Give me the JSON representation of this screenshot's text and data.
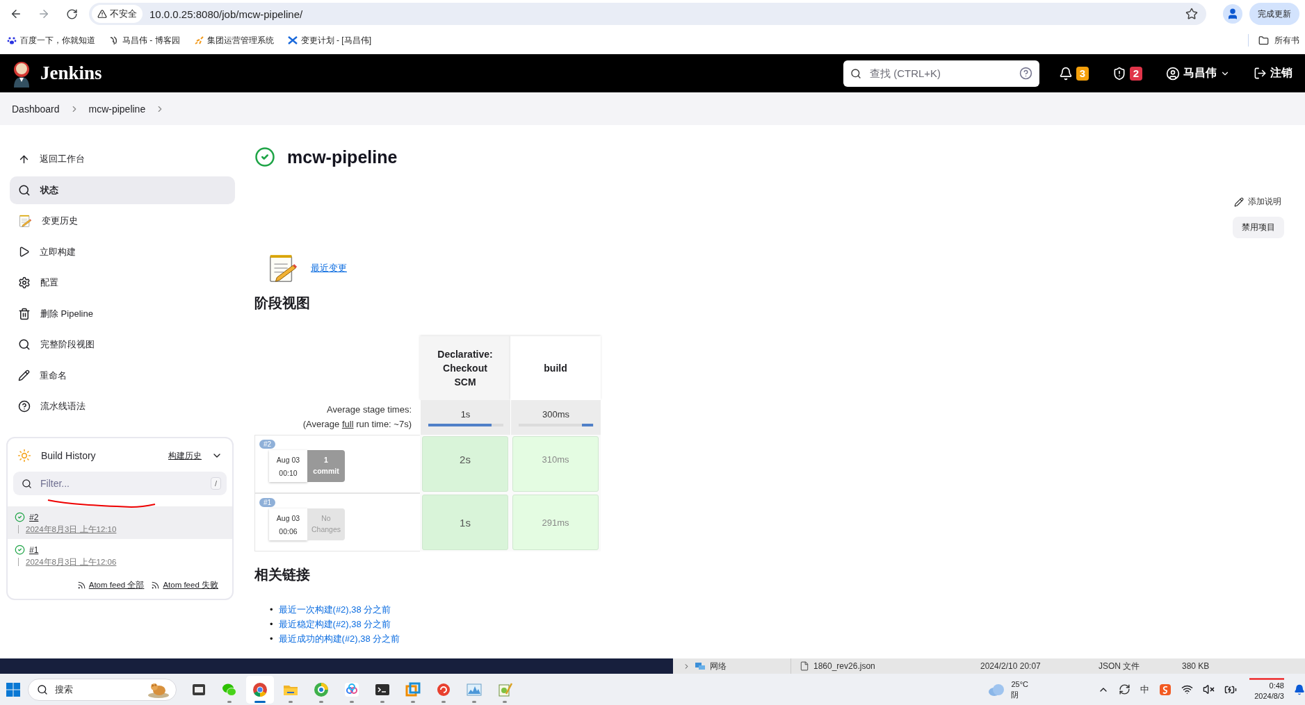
{
  "browser": {
    "security_label": "不安全",
    "url": "10.0.0.25:8080/job/mcw-pipeline/",
    "update_button": "完成更新",
    "bookmarks": [
      "百度一下，你就知道",
      "马昌伟 - 博客园",
      "集团运营管理系统",
      "变更计划 - [马昌伟]"
    ],
    "all_bookmarks": "所有书"
  },
  "header": {
    "brand": "Jenkins",
    "search_placeholder": "查找 (CTRL+K)",
    "notifications": "3",
    "security_warnings": "2",
    "user": "马昌伟",
    "logout": "注销"
  },
  "breadcrumbs": [
    "Dashboard",
    "mcw-pipeline"
  ],
  "sidebar": {
    "items": [
      {
        "label": "返回工作台",
        "selected": false
      },
      {
        "label": "状态",
        "selected": true
      },
      {
        "label": "变更历史",
        "selected": false
      },
      {
        "label": "立即构建",
        "selected": false
      },
      {
        "label": "配置",
        "selected": false
      },
      {
        "label": "删除 Pipeline",
        "selected": false
      },
      {
        "label": "完整阶段视图",
        "selected": false
      },
      {
        "label": "重命名",
        "selected": false
      },
      {
        "label": "流水线语法",
        "selected": false
      }
    ]
  },
  "build_history": {
    "title": "Build History",
    "history_link": "构建历史",
    "filter_placeholder": "Filter...",
    "filter_shortcut": "/",
    "builds": [
      {
        "number": "#2",
        "time": "2024年8月3日 上午12:10",
        "selected": true
      },
      {
        "number": "#1",
        "time": "2024年8月3日 上午12:06",
        "selected": false
      }
    ],
    "feeds": [
      "Atom feed 全部",
      "Atom feed 失败"
    ]
  },
  "job": {
    "title": "mcw-pipeline",
    "add_description": "添加说明",
    "disable_button": "禁用项目",
    "recent_changes": "最近变更"
  },
  "stage_view": {
    "heading": "阶段视图",
    "avg_label": "Average stage times:",
    "avg_prefix": "(Average",
    "avg_link": "full",
    "avg_suffix": "run time: ~7s)",
    "stages": [
      {
        "name": "Declarative: Checkout SCM",
        "avg": "1s",
        "level": 0.85
      },
      {
        "name": "build",
        "avg": "300ms",
        "level": 0.15
      }
    ],
    "runs": [
      {
        "badge": "#2",
        "date": "Aug 03",
        "time": "00:10",
        "changes": "1 commit",
        "kind": "commits",
        "cells": [
          "2s",
          "310ms"
        ]
      },
      {
        "badge": "#1",
        "date": "Aug 03",
        "time": "00:06",
        "changes": "No Changes",
        "kind": "none",
        "cells": [
          "1s",
          "291ms"
        ]
      }
    ]
  },
  "related": {
    "heading": "相关链接",
    "links": [
      {
        "bullet": "•",
        "text": "最近一次构建(#2),38 分之前"
      },
      {
        "bullet": "•",
        "text": "最近稳定构建(#2),38 分之前"
      },
      {
        "bullet": "•",
        "text": "最近成功的构建(#2),38 分之前"
      }
    ]
  },
  "background_window": {
    "nav_item": "网络",
    "file": {
      "name": "1860_rev26.json",
      "modified": "2024/2/10 20:07",
      "type": "JSON 文件",
      "size": "380 KB"
    }
  },
  "taskbar": {
    "search_placeholder": "搜索",
    "apps": [
      {
        "running": false,
        "selected": false
      },
      {
        "running": true,
        "selected": false
      },
      {
        "running": true,
        "selected": true
      },
      {
        "running": true,
        "selected": false
      },
      {
        "running": true,
        "selected": false
      },
      {
        "running": true,
        "selected": false
      },
      {
        "running": true,
        "selected": false
      },
      {
        "running": true,
        "selected": false
      },
      {
        "running": true,
        "selected": false
      },
      {
        "running": true,
        "selected": false
      },
      {
        "running": true,
        "selected": false
      }
    ],
    "weather": {
      "temperature": "25°C",
      "condition": "阴"
    },
    "ime": "中",
    "time": "0:48",
    "date": "2024/8/3"
  }
}
